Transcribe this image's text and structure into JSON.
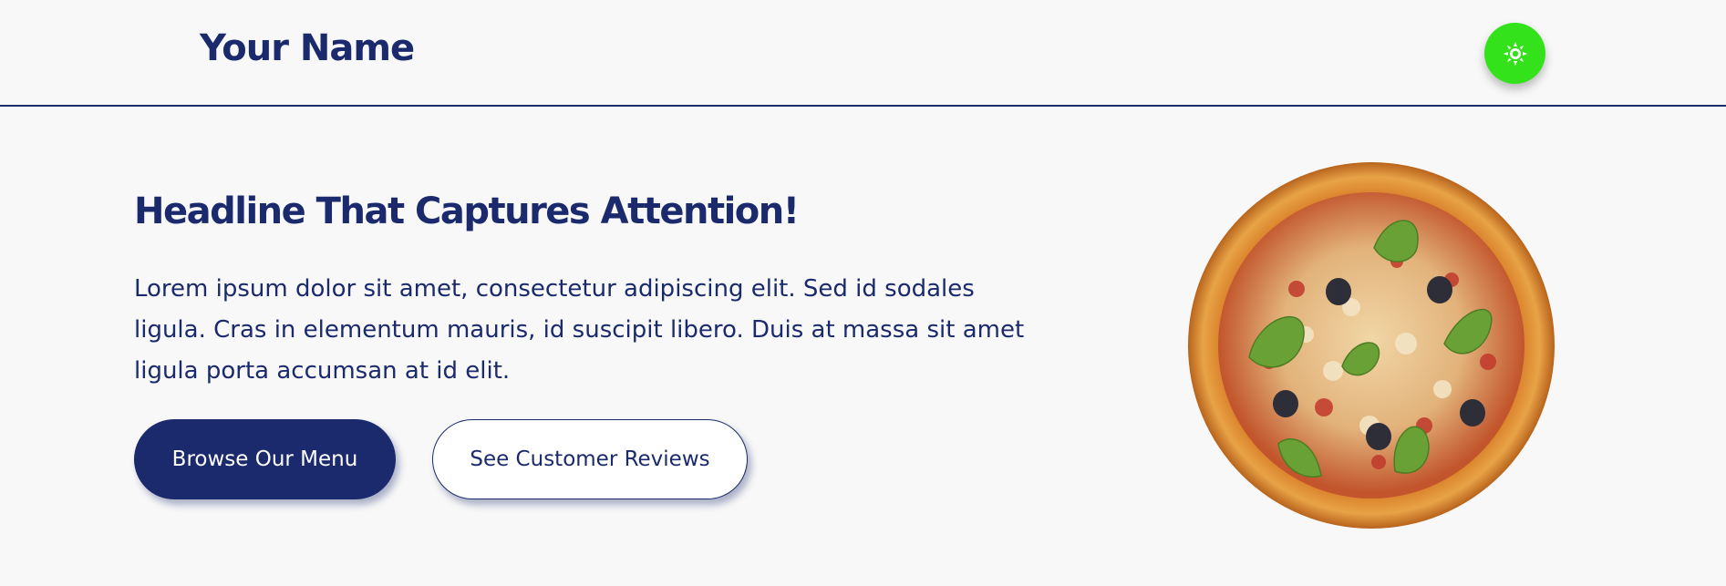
{
  "header": {
    "brand": "Your Name",
    "theme_toggle_icon": "sun-icon",
    "theme_toggle_color": "#34e21c"
  },
  "hero": {
    "headline": "Headline That Captures Attention!",
    "body": "Lorem ipsum dolor sit amet, consectetur adipiscing elit. Sed id sodales ligula. Cras in elementum mauris, id suscipit libero. Duis at massa sit amet ligula porta accumsan at id elit.",
    "primary_button": "Browse Our Menu",
    "secondary_button": "See Customer Reviews",
    "image": "pizza-image"
  },
  "colors": {
    "brand_navy": "#1a2a6c",
    "background": "#f8f8f8",
    "accent_green": "#34e21c"
  }
}
